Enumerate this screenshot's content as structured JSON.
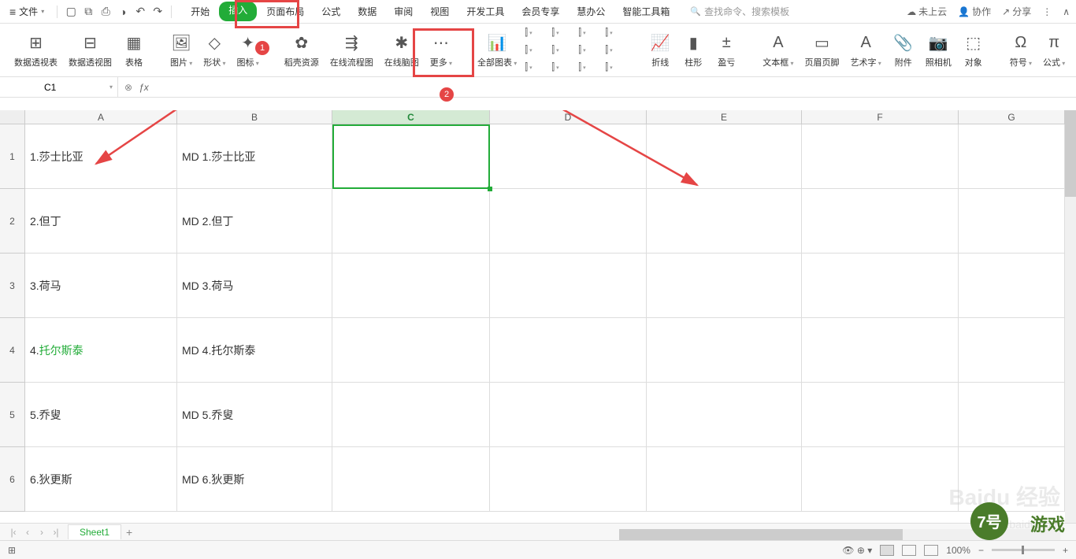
{
  "menu": {
    "file": "文件",
    "tabs": [
      "开始",
      "插入",
      "页面布局",
      "公式",
      "数据",
      "审阅",
      "视图",
      "开发工具",
      "会员专享",
      "慧办公",
      "智能工具箱"
    ],
    "activeTabIndex": 1,
    "searchPlaceholder": "查找命令、搜索模板",
    "cloud": "未上云",
    "collab": "协作",
    "share": "分享"
  },
  "ribbon": {
    "groups": [
      {
        "label": "数据透视表",
        "icon": "pivot-table-icon"
      },
      {
        "label": "数据透视图",
        "icon": "pivot-chart-icon"
      },
      {
        "label": "表格",
        "icon": "table-icon"
      },
      {
        "label": "图片",
        "icon": "picture-icon",
        "dd": true
      },
      {
        "label": "形状",
        "icon": "shapes-icon",
        "dd": true
      },
      {
        "label": "图标",
        "icon": "icons-icon",
        "dd": true
      },
      {
        "label": "稻壳资源",
        "icon": "docer-icon"
      },
      {
        "label": "在线流程图",
        "icon": "flowchart-icon"
      },
      {
        "label": "在线脑图",
        "icon": "mindmap-icon"
      },
      {
        "label": "更多",
        "icon": "more-icon",
        "dd": true
      },
      {
        "label": "全部图表",
        "icon": "all-charts-icon",
        "dd": true
      },
      {
        "label": "折线",
        "icon": "sparkline-line-icon"
      },
      {
        "label": "柱形",
        "icon": "sparkline-bar-icon"
      },
      {
        "label": "盈亏",
        "icon": "sparkline-winloss-icon"
      },
      {
        "label": "文本框",
        "icon": "textbox-icon",
        "dd": true
      },
      {
        "label": "页眉页脚",
        "icon": "header-footer-icon"
      },
      {
        "label": "艺术字",
        "icon": "wordart-icon",
        "dd": true
      },
      {
        "label": "附件",
        "icon": "attachment-icon"
      },
      {
        "label": "照相机",
        "icon": "camera-icon"
      },
      {
        "label": "对象",
        "icon": "object-icon"
      },
      {
        "label": "符号",
        "icon": "symbol-icon",
        "dd": true
      },
      {
        "label": "公式",
        "icon": "equation-icon",
        "dd": true
      }
    ]
  },
  "nameBox": "C1",
  "columns": [
    "A",
    "B",
    "C",
    "D",
    "E",
    "F",
    "G"
  ],
  "colWidths": [
    "wA",
    "wB",
    "wC",
    "wD",
    "wE",
    "wF",
    "wG"
  ],
  "activeCol": 2,
  "rows": [
    {
      "n": "1",
      "a": "1.莎士比亚",
      "b": "MD 1.莎士比亚"
    },
    {
      "n": "2",
      "a": "2.但丁",
      "b": "MD 2.但丁"
    },
    {
      "n": "3",
      "a": "3.荷马",
      "b": "MD 3.荷马"
    },
    {
      "n": "4",
      "a": "4.托尔斯泰",
      "b": "MD 4.托尔斯泰",
      "alink": true,
      "atext": "托尔斯泰",
      "aprefix": "4."
    },
    {
      "n": "5",
      "a": "5.乔叟",
      "b": "MD 5.乔叟"
    },
    {
      "n": "6",
      "a": "6.狄更斯",
      "b": "MD 6.狄更斯"
    }
  ],
  "sheetTab": "Sheet1",
  "zoom": "100%",
  "badges": {
    "b1": "1",
    "b2": "2"
  },
  "watermark": {
    "main": "Baidu 经验",
    "sub": "jingyan.baidu.com",
    "game": "7号游戏"
  }
}
